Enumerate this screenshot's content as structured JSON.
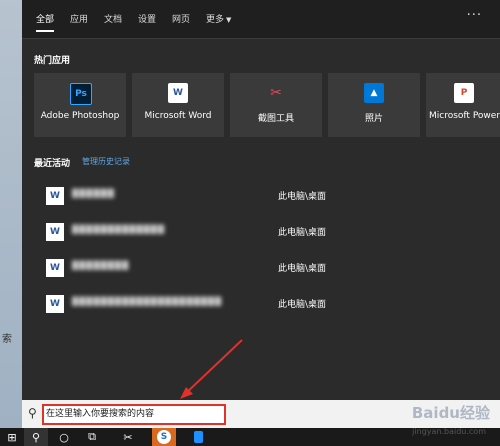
{
  "tabs": [
    {
      "label": "全部",
      "active": true
    },
    {
      "label": "应用"
    },
    {
      "label": "文档"
    },
    {
      "label": "设置"
    },
    {
      "label": "网页"
    },
    {
      "label": "更多"
    }
  ],
  "more_ellipsis": "···",
  "hot_apps": {
    "title": "热门应用",
    "items": [
      {
        "label": "Adobe Photoshop",
        "icon": "photoshop-icon",
        "icon_text": "Ps"
      },
      {
        "label": "Microsoft Word",
        "icon": "word-icon",
        "icon_text": "W"
      },
      {
        "label": "截图工具",
        "icon": "snipping-tool-icon",
        "icon_text": "✂"
      },
      {
        "label": "照片",
        "icon": "photos-icon",
        "icon_text": "▲"
      },
      {
        "label": "Microsoft PowerPoint",
        "icon": "powerpoint-icon",
        "icon_text": "P"
      }
    ]
  },
  "recent": {
    "title": "最近活动",
    "manage_link": "管理历史记录",
    "items": [
      {
        "name": "██████",
        "path": "此电脑\\桌面"
      },
      {
        "name": "█████████████",
        "path": "此电脑\\桌面"
      },
      {
        "name": "████████",
        "path": "此电脑\\桌面"
      },
      {
        "name": "█████████████████████",
        "path": "此电脑\\桌面"
      }
    ]
  },
  "search": {
    "placeholder": "在这里输入你要搜索的内容"
  },
  "desktop_text": "索",
  "watermark": "Baidu经验",
  "watermark_sub": "jingyan.baidu.com",
  "colors": {
    "panel_bg": "#2b2b2b",
    "tile_bg": "#3a3a3a",
    "link": "#5fa8e8",
    "annotation_red": "#e0312b"
  }
}
